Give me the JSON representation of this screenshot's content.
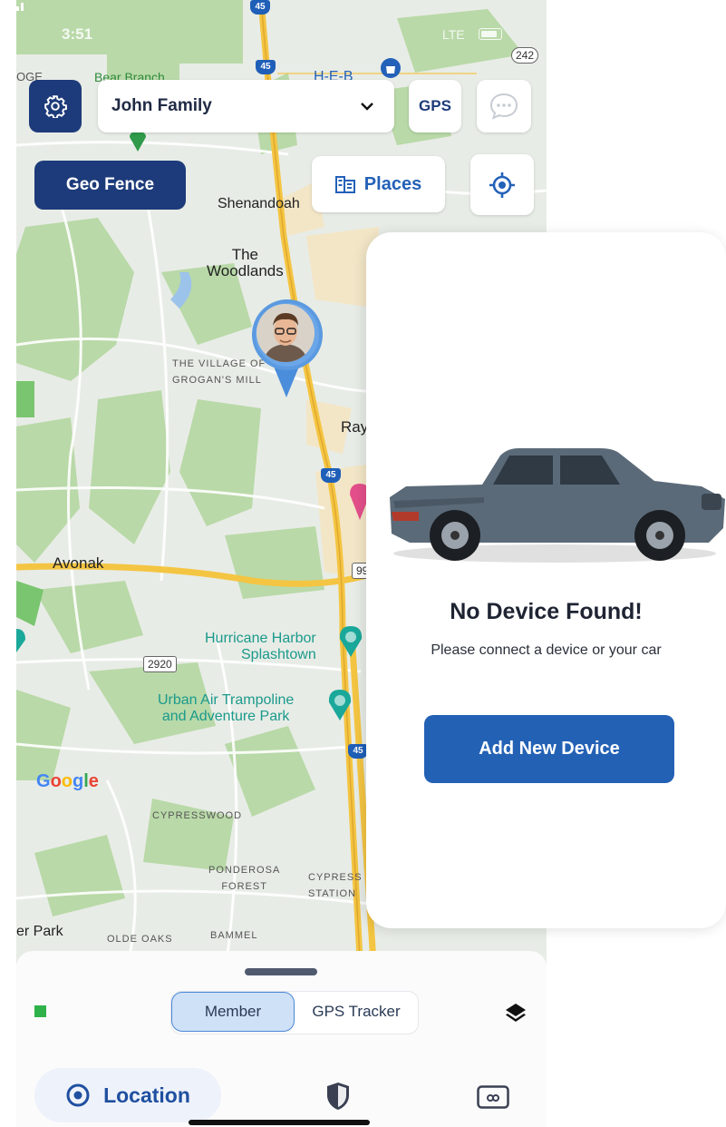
{
  "status_bar": {
    "time": "3:51",
    "network": "LTE"
  },
  "top_bar": {
    "group_name": "John Family",
    "gps_label": "GPS"
  },
  "actions": {
    "geo_fence_label": "Geo Fence",
    "places_label": "Places"
  },
  "map": {
    "labels": {
      "bear_branch": "Bear Branch",
      "heb": "H-E-B",
      "oge": "OGE",
      "shenandoah": "Shenandoah",
      "the_woodlands": "The\nWoodlands",
      "village": "THE VILLAGE OF\nGROGAN'S MILL",
      "ray": "Ray",
      "avonak": "Avonak",
      "hurricane": "Hurricane Harbor\nSplashtown",
      "urban_air": "Urban Air Trampoline\nand Adventure Park",
      "cypresswood": "CYPRESSWOOD",
      "ponderosa": "PONDEROSA\nFOREST",
      "cypress_station": "CYPRESS\nSTATION",
      "er_park": "er Park",
      "olde_oaks": "OLDE OAKS",
      "bammel": "BAMMEL",
      "google": "Google"
    },
    "route_shields": {
      "i45_top": "45",
      "i45_a": "45",
      "i45_b": "45",
      "i45_c": "45",
      "r242": "242",
      "r99": "99",
      "r2920": "2920"
    }
  },
  "device_card": {
    "title": "No Device Found!",
    "subtitle": "Please connect a device or your car",
    "button_label": "Add New Device"
  },
  "bottom_sheet": {
    "segments": [
      "Member",
      "GPS Tracker"
    ],
    "selected_segment": "Member"
  },
  "tab_bar": {
    "location_label": "Location",
    "active_tab": "Location"
  },
  "colors": {
    "primary_dark": "#1d3b7a",
    "primary": "#2361b5",
    "online": "#2fb24a"
  }
}
